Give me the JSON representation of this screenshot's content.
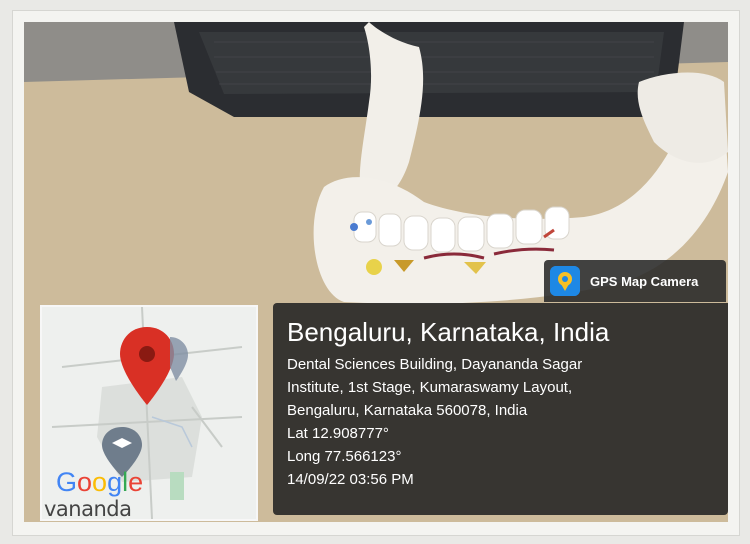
{
  "photo": {
    "subject": "jaw-model-photo",
    "accent_colors": {
      "model": "#f1ede6",
      "table": "#c9b799",
      "chair": "#2a2c30"
    }
  },
  "map": {
    "logo_letters": [
      "G",
      "o",
      "o",
      "g",
      "l",
      "e"
    ],
    "logo_colors": [
      "#4285f4",
      "#ea4335",
      "#fbbc05",
      "#4285f4",
      "#34a853",
      "#ea4335"
    ],
    "caption": "vananda",
    "pin_color": "#d93025",
    "icons": [
      "map-pin-icon",
      "graduation-cap-icon"
    ]
  },
  "badge": {
    "label": "GPS Map Camera",
    "icon": "gps-camera-icon",
    "color": "#1e88e5"
  },
  "location": {
    "city": "Bengaluru, Karnataka, India",
    "address_lines": [
      "Dental Sciences Building, Dayananda Sagar",
      "Institute, 1st Stage, Kumaraswamy Layout,",
      "Bengaluru, Karnataka 560078, India"
    ],
    "lat": "Lat 12.908777°",
    "long": "Long 77.566123°",
    "timestamp": "14/09/22 03:56 PM"
  }
}
